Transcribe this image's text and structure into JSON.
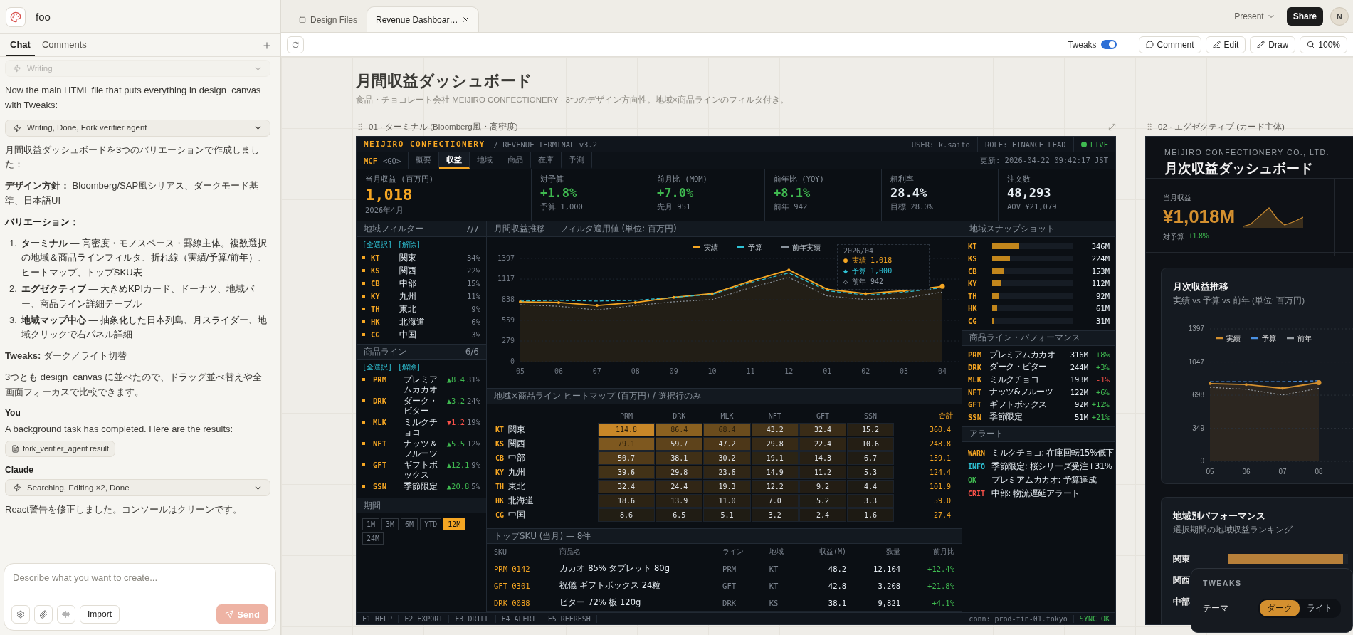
{
  "project": {
    "name": "foo"
  },
  "chat": {
    "tabs": [
      {
        "label": "Chat",
        "selected": true
      },
      {
        "label": "Comments",
        "selected": false
      }
    ],
    "items": [
      {
        "kind": "tool",
        "label": "Writing",
        "faded": true
      },
      {
        "kind": "text",
        "text": "Now the main HTML file that puts everything in design_canvas with Tweaks:"
      },
      {
        "kind": "tool",
        "label": "Writing, Done, Fork verifier agent",
        "faded": false
      },
      {
        "kind": "text",
        "text": "月間収益ダッシュボードを3つのバリエーションで作成しました："
      },
      {
        "kind": "text",
        "text": "**デザイン方針：** Bloomberg/SAP風シリアス、ダークモード基準、日本語UI"
      },
      {
        "kind": "heading",
        "text": "**バリエーション：**"
      },
      {
        "kind": "list",
        "items": [
          {
            "number": "1.",
            "text": "**ターミナル** — 高密度・モノスペース・罫線主体。複数選択の地域＆商品ラインフィルタ、折れ線（実績/予算/前年）、ヒートマップ、トップSKU表"
          },
          {
            "number": "2.",
            "text": "**エグゼクティブ** — 大きめKPIカード、ドーナツ、地域バー、商品ライン詳細テーブル"
          },
          {
            "number": "3.",
            "text": "**地域マップ中心** — 抽象化した日本列島、月スライダー、地域クリックで右パネル詳細"
          }
        ]
      },
      {
        "kind": "text",
        "text": "**Tweaks:** ダーク／ライト切替"
      },
      {
        "kind": "text",
        "text": "3つとも design_canvas に並べたので、ドラッグ並べ替えや全画面フォーカスで比較できます。"
      },
      {
        "kind": "author",
        "text": "**You**"
      },
      {
        "kind": "text",
        "text": "A background task has completed. Here are the results:"
      },
      {
        "kind": "file",
        "text": "fork_verifier_agent result"
      },
      {
        "kind": "author",
        "text": "**Claude**"
      },
      {
        "kind": "tool",
        "label": "Searching, Editing ×2, Done",
        "faded": false
      },
      {
        "kind": "text",
        "text": "React警告を修正しました。コンソールはクリーンです。"
      }
    ],
    "composer": {
      "placeholder": "Describe what you want to create...",
      "import": "Import",
      "send": "Send"
    }
  },
  "topbar": {
    "tabs": [
      {
        "label": "Design Files",
        "selected": false,
        "closable": false
      },
      {
        "label": "Revenue Dashboar…",
        "selected": true,
        "closable": true
      }
    ],
    "present": "Present",
    "share": "Share",
    "avatar": "N"
  },
  "toolbar": {
    "tweaks": {
      "label": "Tweaks",
      "on": true
    },
    "buttons": [
      "Comment",
      "Edit",
      "Draw",
      "100%"
    ]
  },
  "canvas": {
    "title": "月間収益ダッシュボード",
    "subtitle": "食品・チョコレート会社 MEIJIRO CONFECTIONERY · 3つのデザイン方向性。地域×商品ラインのフィルタ付き。",
    "artboards": [
      "01 · ターミナル (Bloomberg風・高密度)",
      "02 · エグゼクティブ (カード主体)"
    ]
  },
  "terminal": {
    "brand": "MEIJIRO CONFECTIONERY",
    "product": "/ REVENUE TERMINAL v3.2",
    "user": "USER: k.saito",
    "role": "ROLE: FINANCE_LEAD",
    "status": "LIVE",
    "ticker": "MCF",
    "go": "<GO>",
    "tabs": [
      {
        "label": "概要",
        "selected": false
      },
      {
        "label": "収益",
        "selected": true
      },
      {
        "label": "地域",
        "selected": false
      },
      {
        "label": "商品",
        "selected": false
      },
      {
        "label": "在庫",
        "selected": false
      },
      {
        "label": "予測",
        "selected": false
      }
    ],
    "updated": "更新: 2026-04-22 09:42:17 JST",
    "kpis": [
      {
        "label": "当月収益 (百万円)",
        "value": "1,018",
        "sub": "2026年4月",
        "color": "#f5a623"
      },
      {
        "label": "対予算",
        "value": "+1.8%",
        "sub": "予算 1,000",
        "color": "#3fb950"
      },
      {
        "label": "前月比 (MOM)",
        "value": "+7.0%",
        "sub": "先月 951",
        "color": "#3fb950"
      },
      {
        "label": "前年比 (YOY)",
        "value": "+8.1%",
        "sub": "前年 942",
        "color": "#3fb950"
      },
      {
        "label": "粗利率",
        "value": "28.4%",
        "sub": "目標 28.0%",
        "color": "#e6edf3"
      },
      {
        "label": "注文数",
        "value": "48,293",
        "sub": "AOV ¥21,079",
        "color": "#e6edf3"
      }
    ],
    "region_filter": {
      "title": "地域フィルター",
      "count": "7/7",
      "links": [
        "[全選択]",
        "[解除]"
      ],
      "items": [
        {
          "code": "KT",
          "name": "関東",
          "share": "34%",
          "selected": true
        },
        {
          "code": "KS",
          "name": "関西",
          "share": "22%",
          "selected": true
        },
        {
          "code": "CB",
          "name": "中部",
          "share": "15%",
          "selected": true
        },
        {
          "code": "KY",
          "name": "九州",
          "share": "11%",
          "selected": true
        },
        {
          "code": "TH",
          "name": "東北",
          "share": "9%",
          "selected": true
        },
        {
          "code": "HK",
          "name": "北海道",
          "share": "6%",
          "selected": true
        },
        {
          "code": "CG",
          "name": "中国",
          "share": "3%",
          "selected": true
        }
      ]
    },
    "product_filter": {
      "title": "商品ライン",
      "count": "6/6",
      "links": [
        "[全選択]",
        "[解除]"
      ],
      "items": [
        {
          "code": "PRM",
          "name": "プレミアムカカオ",
          "change": "▲8.4",
          "up": true,
          "share": "31%",
          "selected": true
        },
        {
          "code": "DRK",
          "name": "ダーク・ビター",
          "change": "▲3.2",
          "up": true,
          "share": "24%",
          "selected": true
        },
        {
          "code": "MLK",
          "name": "ミルクチョコ",
          "change": "▼1.2",
          "up": false,
          "share": "19%",
          "selected": true
        },
        {
          "code": "NFT",
          "name": "ナッツ＆フルーツ",
          "change": "▲5.5",
          "up": true,
          "share": "12%",
          "selected": true
        },
        {
          "code": "GFT",
          "name": "ギフトボックス",
          "change": "▲12.1",
          "up": true,
          "share": "9%",
          "selected": true
        },
        {
          "code": "SSN",
          "name": "季節限定",
          "change": "▲20.8",
          "up": true,
          "share": "5%",
          "selected": true
        }
      ]
    },
    "period": {
      "title": "期間",
      "options": [
        {
          "label": "1M",
          "selected": false
        },
        {
          "label": "3M",
          "selected": false
        },
        {
          "label": "6M",
          "selected": false
        },
        {
          "label": "YTD",
          "selected": false
        },
        {
          "label": "12M",
          "selected": true
        },
        {
          "label": "24M",
          "selected": false
        }
      ]
    },
    "trend": {
      "title": "月間収益推移 — フィルタ適用値 (単位: 百万円)",
      "tooltip": {
        "title": "2026/04",
        "rows": [
          "● 実績 1,018",
          "◆ 予算 1,000",
          "◇ 前年 942"
        ]
      },
      "chart_data": {
        "type": "line",
        "categories": [
          "05",
          "06",
          "07",
          "08",
          "09",
          "10",
          "11",
          "12",
          "01",
          "02",
          "03",
          "04"
        ],
        "ylim": [
          0,
          1397
        ],
        "yticks": [
          0,
          279,
          559,
          838,
          1117,
          1397
        ],
        "grid": true,
        "legend": true,
        "series": [
          {
            "name": "実績",
            "color": "#f5a623",
            "type": "area",
            "line_style": "solid",
            "values": [
              810,
              800,
              760,
              800,
              870,
              920,
              1090,
              1240,
              980,
              920,
              960,
              1018
            ]
          },
          {
            "name": "予算",
            "color": "#2fc3d6",
            "line_style": "dashed",
            "values": [
              820,
              830,
              820,
              830,
              870,
              910,
              1070,
              1200,
              960,
              900,
              940,
              1000
            ]
          },
          {
            "name": "前年実績",
            "color": "#8b949e",
            "line_style": "dotted",
            "values": [
              770,
              750,
              700,
              760,
              810,
              840,
              1000,
              1140,
              890,
              840,
              860,
              942
            ]
          }
        ]
      }
    },
    "heatmap": {
      "title": "地域×商品ライン ヒートマップ (百万円) / 選択行のみ",
      "columns": [
        "PRM",
        "DRK",
        "MLK",
        "NFT",
        "GFT",
        "SSN"
      ],
      "total_label": "合計",
      "rows": [
        {
          "code": "KT",
          "name": "関東",
          "values": [
            "114.8",
            "86.4",
            "68.4",
            "43.2",
            "32.4",
            "15.2"
          ],
          "total": "360.4"
        },
        {
          "code": "KS",
          "name": "関西",
          "values": [
            "79.1",
            "59.7",
            "47.2",
            "29.8",
            "22.4",
            "10.6"
          ],
          "total": "248.8"
        },
        {
          "code": "CB",
          "name": "中部",
          "values": [
            "50.7",
            "38.1",
            "30.2",
            "19.1",
            "14.3",
            "6.7"
          ],
          "total": "159.1"
        },
        {
          "code": "KY",
          "name": "九州",
          "values": [
            "39.6",
            "29.8",
            "23.6",
            "14.9",
            "11.2",
            "5.3"
          ],
          "total": "124.4"
        },
        {
          "code": "TH",
          "name": "東北",
          "values": [
            "32.4",
            "24.4",
            "19.3",
            "12.2",
            "9.2",
            "4.4"
          ],
          "total": "101.9"
        },
        {
          "code": "HK",
          "name": "北海道",
          "values": [
            "18.6",
            "13.9",
            "11.0",
            "7.0",
            "5.2",
            "3.3"
          ],
          "total": "59.0"
        },
        {
          "code": "CG",
          "name": "中国",
          "values": [
            "8.6",
            "6.5",
            "5.1",
            "3.2",
            "2.4",
            "1.6"
          ],
          "total": "27.4"
        }
      ]
    },
    "top_sku": {
      "title": "トップSKU (当月) — 8件",
      "columns": [
        "SKU",
        "商品名",
        "ライン",
        "地域",
        "収益(M)",
        "数量",
        "前月比"
      ],
      "rows": [
        [
          "PRM-0142",
          "カカオ 85% タブレット 80g",
          "PRM",
          "KT",
          "48.2",
          "12,104",
          "+12.4%"
        ],
        [
          "GFT-0301",
          "祝儀 ギフトボックス 24粒",
          "GFT",
          "KT",
          "42.8",
          "3,208",
          "+21.8%"
        ],
        [
          "DRK-0088",
          "ビター 72% 板 120g",
          "DRK",
          "KS",
          "38.1",
          "9,821",
          "+4.1%"
        ]
      ]
    },
    "snapshot": {
      "title": "地域スナップショット",
      "items": [
        {
          "code": "KT",
          "value": "346M",
          "level": 0.34
        },
        {
          "code": "KS",
          "value": "224M",
          "level": 0.22
        },
        {
          "code": "CB",
          "value": "153M",
          "level": 0.15
        },
        {
          "code": "KY",
          "value": "112M",
          "level": 0.11
        },
        {
          "code": "TH",
          "value": "92M",
          "level": 0.09
        },
        {
          "code": "HK",
          "value": "61M",
          "level": 0.06
        },
        {
          "code": "CG",
          "value": "31M",
          "level": 0.03
        }
      ]
    },
    "performance": {
      "title": "商品ライン・パフォーマンス",
      "items": [
        {
          "code": "PRM",
          "name": "プレミアムカカオ",
          "value": "316M",
          "change": "+8%",
          "up": true
        },
        {
          "code": "DRK",
          "name": "ダーク・ビター",
          "value": "244M",
          "change": "+3%",
          "up": true
        },
        {
          "code": "MLK",
          "name": "ミルクチョコ",
          "value": "193M",
          "change": "-1%",
          "up": false
        },
        {
          "code": "NFT",
          "name": "ナッツ&フルーツ",
          "value": "122M",
          "change": "+6%",
          "up": true
        },
        {
          "code": "GFT",
          "name": "ギフトボックス",
          "value": "92M",
          "change": "+12%",
          "up": true
        },
        {
          "code": "SSN",
          "name": "季節限定",
          "value": "51M",
          "change": "+21%",
          "up": true
        }
      ]
    },
    "alerts": {
      "title": "アラート",
      "items": [
        {
          "tag": "WARN",
          "color": "#f5a623",
          "text": "ミルクチョコ: 在庫回転15%低下"
        },
        {
          "tag": "INFO",
          "color": "#2fc3d6",
          "text": "季節限定: 桜シリーズ受注+31%"
        },
        {
          "tag": "OK",
          "color": "#3fb950",
          "text": "プレミアムカカオ: 予算達成"
        },
        {
          "tag": "CRIT",
          "color": "#f85149",
          "text": "中部: 物流遅延アラート"
        }
      ]
    },
    "footer": {
      "keys": [
        "F1 HELP",
        "F2 EXPORT",
        "F3 DRILL",
        "F4 ALERT",
        "F5 REFRESH"
      ],
      "connection": "conn: prod-fin-01.tokyo",
      "sync": "SYNC OK"
    }
  },
  "executive": {
    "company": "MEIJIRO CONFECTIONERY CO., LTD.",
    "title": "月次収益ダッシュボード",
    "kpi": {
      "label": "当月収益",
      "value": "¥1,018M",
      "sub_label": "対予算",
      "sub_value": "+1.8%"
    },
    "trend": {
      "title": "月次収益推移",
      "subtitle": "実績 vs 予算 vs 前年 (単位: 百万円)",
      "chart_data": {
        "type": "line",
        "categories": [
          "05",
          "06",
          "07",
          "08"
        ],
        "ylim": [
          0,
          1397
        ],
        "yticks": [
          0,
          349,
          698,
          1047,
          1397
        ],
        "grid": true,
        "legend": true,
        "series": [
          {
            "name": "実績",
            "color": "#d4902f",
            "type": "area",
            "line_style": "solid",
            "values": [
              820,
              810,
              770,
              830
            ]
          },
          {
            "name": "予算",
            "color": "#4a90e2",
            "line_style": "dashed",
            "values": [
              840,
              840,
              840,
              850
            ]
          },
          {
            "name": "前年",
            "color": "#9aa0a6",
            "line_style": "dotted",
            "values": [
              780,
              760,
              700,
              770
            ]
          }
        ]
      }
    },
    "regions": {
      "title": "地域別パフォーマンス",
      "subtitle": "選択期間の地域収益ランキング",
      "items": [
        {
          "name": "関東",
          "level": 0.96
        },
        {
          "name": "関西"
        },
        {
          "name": "中部"
        }
      ]
    }
  },
  "tweaks": {
    "title": "TWEAKS",
    "label": "テーマ",
    "options": [
      {
        "label": "ダーク",
        "selected": true
      },
      {
        "label": "ライト",
        "selected": false
      }
    ]
  }
}
